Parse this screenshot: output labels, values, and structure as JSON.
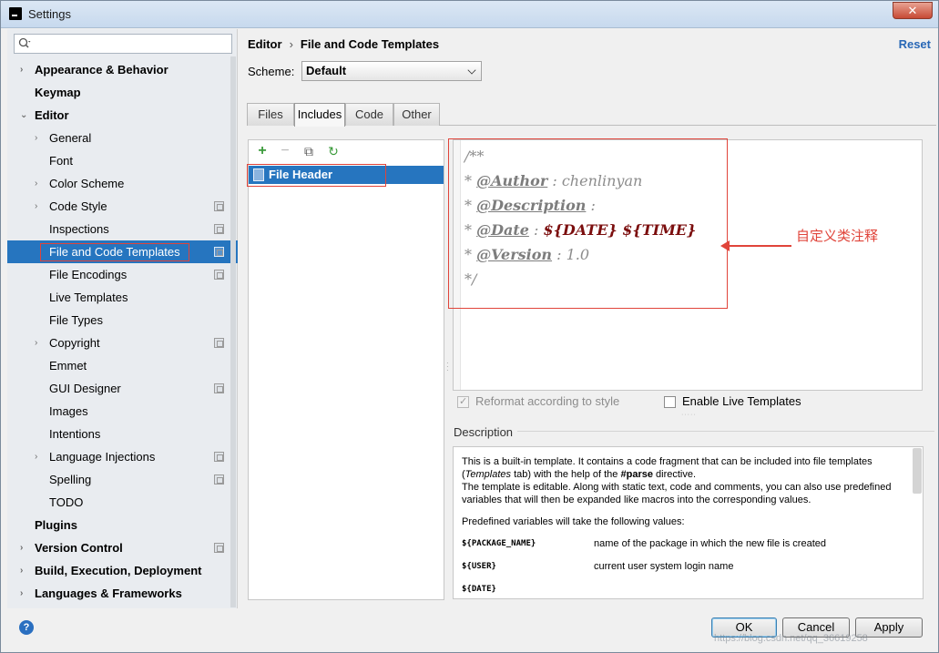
{
  "window": {
    "title": "Settings",
    "close_glyph": "✕"
  },
  "sidebar": {
    "search_placeholder": "",
    "items": [
      {
        "label": "Appearance & Behavior",
        "arrow": "›",
        "bold": true
      },
      {
        "label": "Keymap",
        "bold": true
      },
      {
        "label": "Editor",
        "arrow": "⌄",
        "bold": true
      },
      {
        "label": "General",
        "arrow": "›"
      },
      {
        "label": "Font"
      },
      {
        "label": "Color Scheme",
        "arrow": "›"
      },
      {
        "label": "Code Style",
        "arrow": "›"
      },
      {
        "label": "Inspections"
      },
      {
        "label": "File and Code Templates",
        "selected": true
      },
      {
        "label": "File Encodings"
      },
      {
        "label": "Live Templates"
      },
      {
        "label": "File Types"
      },
      {
        "label": "Copyright",
        "arrow": "›"
      },
      {
        "label": "Emmet"
      },
      {
        "label": "GUI Designer"
      },
      {
        "label": "Images"
      },
      {
        "label": "Intentions"
      },
      {
        "label": "Language Injections",
        "arrow": "›"
      },
      {
        "label": "Spelling"
      },
      {
        "label": "TODO"
      },
      {
        "label": "Plugins",
        "bold": true
      },
      {
        "label": "Version Control",
        "arrow": "›",
        "bold": true
      },
      {
        "label": "Build, Execution, Deployment",
        "arrow": "›",
        "bold": true
      },
      {
        "label": "Languages & Frameworks",
        "arrow": "›",
        "bold": true
      }
    ]
  },
  "header": {
    "breadcrumb_parent": "Editor",
    "breadcrumb_sep": "›",
    "breadcrumb_current": "File and Code Templates",
    "reset_label": "Reset"
  },
  "scheme": {
    "label": "Scheme:",
    "value": "Default"
  },
  "tabs": [
    "Files",
    "Includes",
    "Code",
    "Other"
  ],
  "active_tab": "Includes",
  "toolbar": {
    "add": "+",
    "remove": "−",
    "copy": "⧉",
    "reset": "↻"
  },
  "templates": [
    {
      "name": "File Header"
    }
  ],
  "editor": {
    "lines": [
      {
        "prefix": "/**",
        "tag": "",
        "sep": "",
        "value": "",
        "kind": "plain"
      },
      {
        "prefix": "* ",
        "tag": "@Author",
        "sep": " : ",
        "value": "chenlinyan",
        "kind": "plain"
      },
      {
        "prefix": "* ",
        "tag": "@Description",
        "sep": " :",
        "value": "",
        "kind": "plain"
      },
      {
        "prefix": "* ",
        "tag": "@Date",
        "sep": " : ",
        "value": "${DATE} ${TIME}",
        "kind": "var"
      },
      {
        "prefix": "* ",
        "tag": "@Version",
        "sep": " : ",
        "value": "1.0",
        "kind": "plain"
      },
      {
        "prefix": "*/",
        "tag": "",
        "sep": "",
        "value": "",
        "kind": "plain"
      }
    ]
  },
  "annotation": {
    "text": "自定义类注释"
  },
  "options": {
    "reformat_label": "Reformat according to style",
    "live_templates_label": "Enable Live Templates"
  },
  "description": {
    "title": "Description",
    "p1_a": "This is a built-in template. It contains a code fragment that can be included into file templates (",
    "p1_b": "Templates",
    "p1_c": " tab) with the help of the ",
    "p1_d": "#parse",
    "p1_e": " directive.",
    "p2": "The template is editable. Along with static text, code and comments, you can also use predefined variables that will then be expanded like macros into the corresponding values.",
    "p3": "Predefined variables will take the following values:",
    "vars": [
      {
        "name": "${PACKAGE_NAME}",
        "desc": "name of the package in which the new file is created"
      },
      {
        "name": "${USER}",
        "desc": "current user system login name"
      },
      {
        "name": "${DATE}",
        "desc": ""
      }
    ]
  },
  "footer": {
    "help_glyph": "?",
    "ok_label": "OK",
    "cancel_label": "Cancel",
    "apply_label": "Apply",
    "watermark": "https://blog.csdn.net/qq_36619258"
  }
}
